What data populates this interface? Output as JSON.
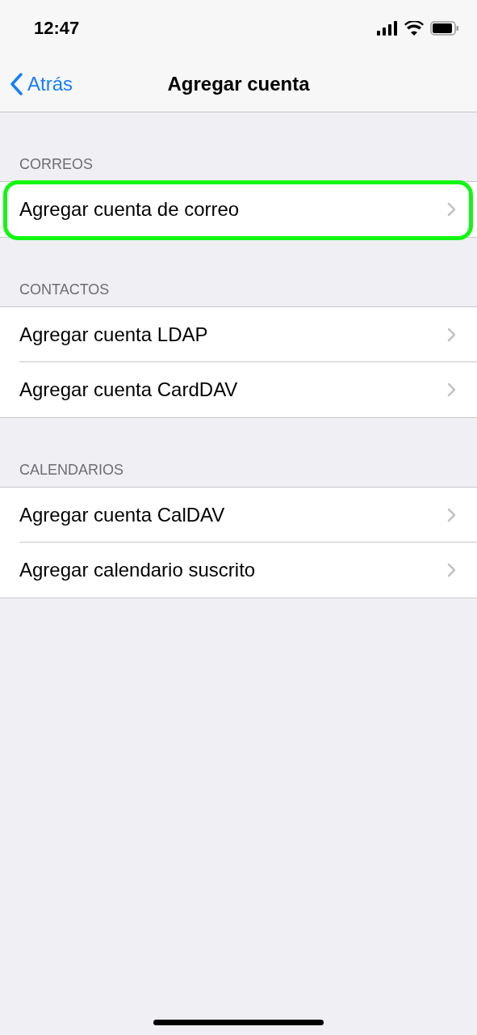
{
  "status_bar": {
    "time": "12:47"
  },
  "nav": {
    "back": "Atrás",
    "title": "Agregar cuenta"
  },
  "sections": [
    {
      "header": "CORREOS",
      "items": [
        {
          "label": "Agregar cuenta de correo",
          "highlighted": true
        }
      ]
    },
    {
      "header": "CONTACTOS",
      "items": [
        {
          "label": "Agregar cuenta LDAP",
          "highlighted": false
        },
        {
          "label": "Agregar cuenta CardDAV",
          "highlighted": false
        }
      ]
    },
    {
      "header": "CALENDARIOS",
      "items": [
        {
          "label": "Agregar cuenta CalDAV",
          "highlighted": false
        },
        {
          "label": "Agregar calendario suscrito",
          "highlighted": false
        }
      ]
    }
  ]
}
